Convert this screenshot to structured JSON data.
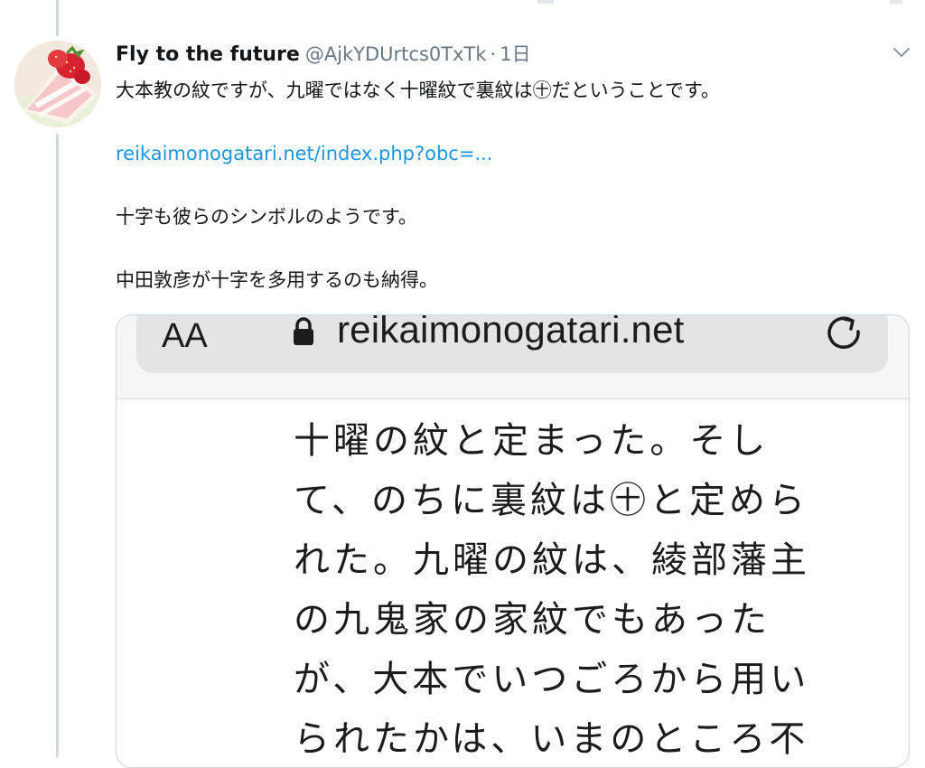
{
  "tweet": {
    "display_name": "Fly to the future",
    "handle": "@AjkYDUrtcs0TxTk",
    "separator": "·",
    "time": "1日",
    "lines": [
      "大本教の紋ですが、九曜ではなく十曜紋で裏紋は㊉だということです。",
      "reikaimonogatari.net/index.php?obc=...",
      "十字も彼らのシンボルのようです。",
      "中田敦彦が十字を多用するのも納得。"
    ]
  },
  "media": {
    "browser_text_size": "AA",
    "domain": "reikaimonogatari.net",
    "page_lines": [
      "十曜の紋と定まった。そし",
      "て、のちに裏紋は㊉と定めら",
      "れた。九曜の紋は、綾部藩主",
      "の九鬼家の家紋でもあった",
      "が、大本でいつごろから用い",
      "られたかは、いまのところ不"
    ]
  },
  "colors": {
    "link": "#1b95e0",
    "secondary_text": "#657786",
    "thread_line": "#cfd9de",
    "border": "#ccd6dd"
  }
}
